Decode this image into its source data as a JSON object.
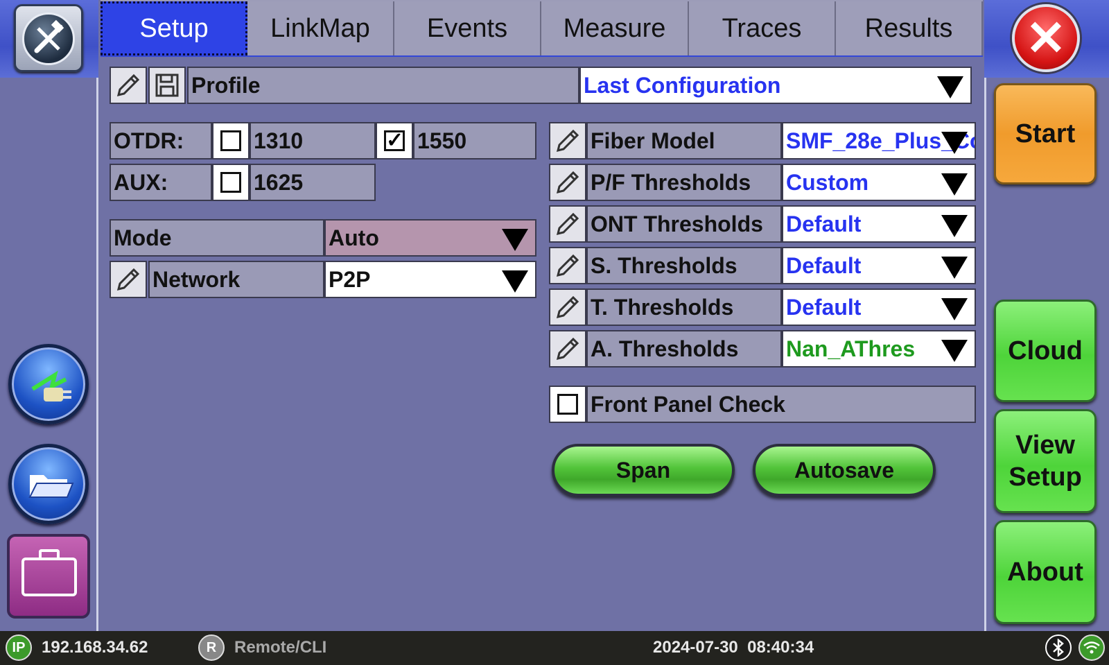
{
  "tabs": [
    {
      "label": "Setup",
      "active": true
    },
    {
      "label": "LinkMap"
    },
    {
      "label": "Events"
    },
    {
      "label": "Measure"
    },
    {
      "label": "Traces"
    },
    {
      "label": "Results"
    }
  ],
  "profile": {
    "label": "Profile",
    "value": "Last Configuration"
  },
  "otdr": {
    "label": "OTDR:",
    "wl1": "1310",
    "wl1_checked": false,
    "wl2": "1550",
    "wl2_checked": true
  },
  "aux": {
    "label": "AUX:",
    "wl": "1625",
    "checked": false
  },
  "mode": {
    "label": "Mode",
    "value": "Auto"
  },
  "network": {
    "label": "Network",
    "value": "P2P"
  },
  "settings": [
    {
      "label": "Fiber Model",
      "value": "SMF_28e_Plus_Co"
    },
    {
      "label": "P/F Thresholds",
      "value": "Custom"
    },
    {
      "label": "ONT Thresholds",
      "value": "Default"
    },
    {
      "label": "S. Thresholds",
      "value": "Default"
    },
    {
      "label": "T. Thresholds",
      "value": "Default"
    },
    {
      "label": "A. Thresholds",
      "value": "Nan_AThres"
    }
  ],
  "front_panel": {
    "label": "Front Panel Check",
    "checked": false
  },
  "buttons": {
    "span": "Span",
    "autosave": "Autosave"
  },
  "side": {
    "start": "Start",
    "cloud": "Cloud",
    "view_setup": "View\nSetup",
    "about": "About"
  },
  "status": {
    "ip_badge": "IP",
    "ip": "192.168.34.62",
    "remote_badge": "R",
    "remote": "Remote/CLI",
    "datetime": "2024-07-30  08:40:34"
  },
  "colors": {
    "tab_active": "#2e43e6",
    "link_value": "#2733f0",
    "green_value": "#1e9a1e",
    "start": "#f09b2c",
    "side_green": "#4ed43a",
    "close": "#d51414"
  },
  "icons": [
    "tools-icon",
    "close-icon",
    "power-connect-icon",
    "folder-icon",
    "toolbox-icon",
    "pencil-icon",
    "save-icon",
    "checkbox-icon",
    "dropdown-arrow-icon",
    "bluetooth-icon",
    "wifi-icon"
  ]
}
